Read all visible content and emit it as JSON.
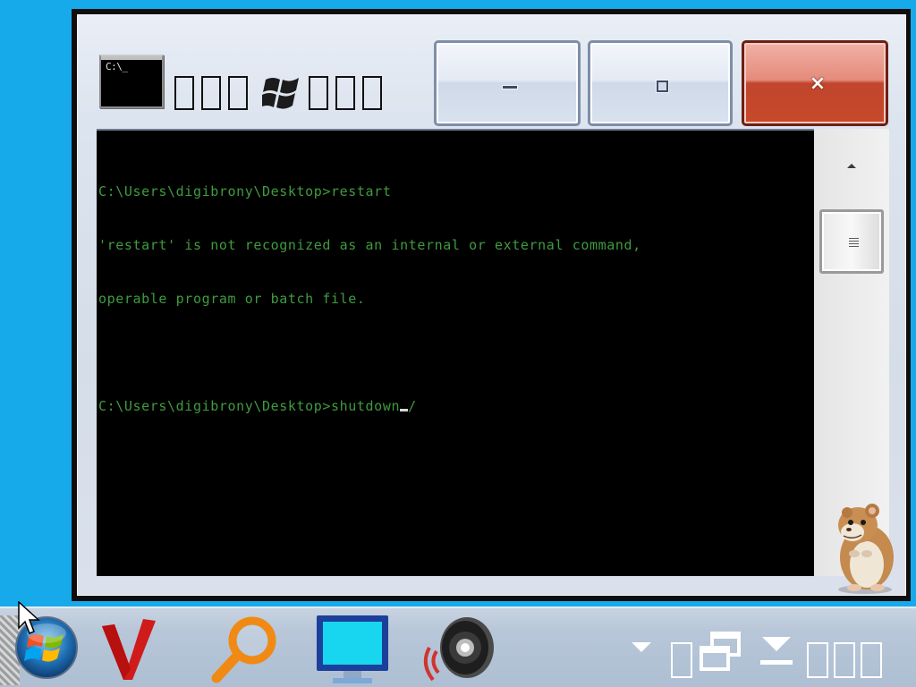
{
  "window": {
    "title_icon_text": "C:\\_",
    "caption_buttons": {
      "minimize": "—",
      "maximize": "□",
      "close": "×"
    }
  },
  "console": {
    "lines": [
      "C:\\Users\\digibrony\\Desktop>restart",
      "'restart' is not recognized as an internal or external command,",
      "operable program or batch file.",
      "",
      "C:\\Users\\digibrony\\Desktop>shutdown"
    ],
    "after_cursor": "/",
    "text_color": "#3f9b3f"
  },
  "colors": {
    "desktop": "#17aaeb",
    "close_button": "#c8482a",
    "console_bg": "#000000"
  },
  "icons": {
    "title": "command-prompt-icon",
    "windows_flag": "windows-flag-icon",
    "scroll_up": "scroll-up-arrow-icon",
    "mascot": "hamster-icon",
    "start": "start-orb-icon",
    "vivaldi": "vivaldi-icon",
    "search": "magnifier-icon",
    "monitor": "monitor-icon",
    "speaker": "speaker-icon",
    "tray_chevron": "chevron-down-icon",
    "tray_windows": "restore-windows-icon",
    "tray_download": "download-icon"
  }
}
